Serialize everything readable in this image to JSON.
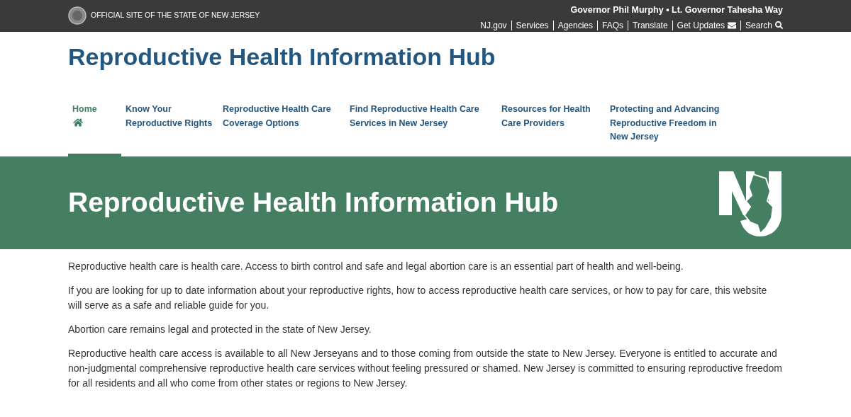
{
  "top_bar": {
    "official_text": "OFFICIAL SITE OF THE STATE OF NEW JERSEY",
    "governor_line": "Governor Phil Murphy • Lt. Governor Tahesha Way",
    "links": [
      {
        "label": "NJ.gov",
        "kind": "text"
      },
      {
        "label": "Services",
        "kind": "text"
      },
      {
        "label": "Agencies",
        "kind": "text"
      },
      {
        "label": "FAQs",
        "kind": "text"
      },
      {
        "label": "Translate",
        "kind": "text"
      },
      {
        "label": "Get Updates",
        "kind": "mail"
      },
      {
        "label": "Search",
        "kind": "search"
      }
    ]
  },
  "site_title": "Reproductive Health Information Hub",
  "nav": [
    {
      "label": "Home",
      "selected": true,
      "kind": "home"
    },
    {
      "label": "Know Your Reproductive Rights",
      "selected": false,
      "kind": "text"
    },
    {
      "label": "Reproductive Health Care Coverage Options",
      "selected": false,
      "kind": "text"
    },
    {
      "label": "Find Reproductive Health Care Services in New Jersey",
      "selected": false,
      "kind": "text"
    },
    {
      "label": "Resources for Health Care Providers",
      "selected": false,
      "kind": "text"
    },
    {
      "label": "Protecting and Advancing Reproductive Freedom in New Jersey",
      "selected": false,
      "kind": "text"
    }
  ],
  "banner": {
    "title": "Reproductive Health Information Hub"
  },
  "paragraphs": [
    "Reproductive health care is health care. Access to birth control and safe and legal abortion care is an essential part of health and well-being.",
    "If you are looking for up to date information about your reproductive rights, how to access reproductive health care services, or how to pay for care, this website will serve as a safe and reliable guide for you.",
    "Abortion care remains legal and protected in the state of New Jersey.",
    "Reproductive health care access is available to all New Jerseyans and to those coming from outside the state to New Jersey. Everyone is entitled to accurate and non-judgmental comprehensive reproductive health care services without feeling pressured or shamed. New Jersey is committed to ensuring reproductive freedom for all residents and all who come from other states or regions to New Jersey."
  ]
}
